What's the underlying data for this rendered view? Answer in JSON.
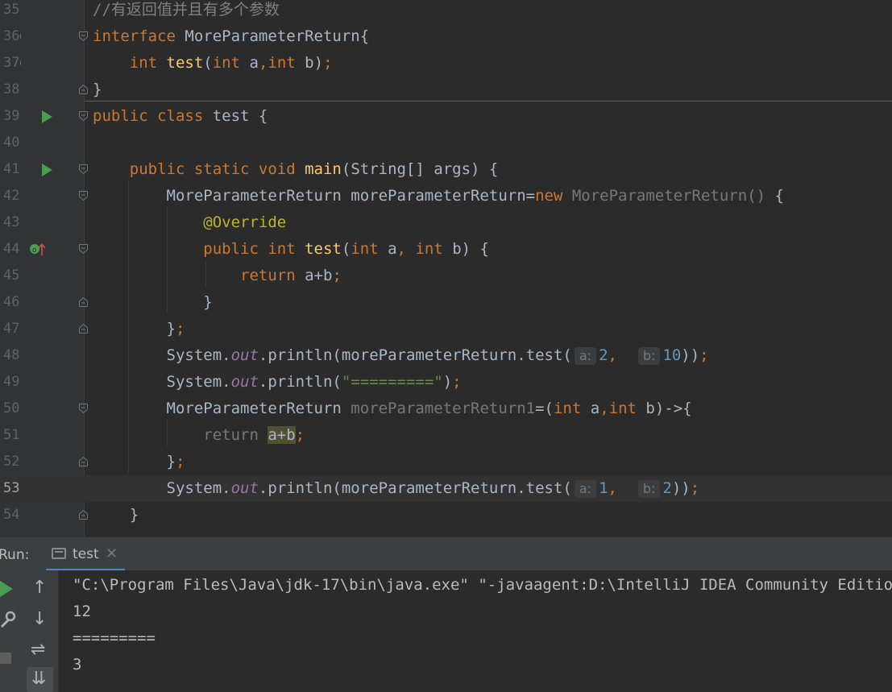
{
  "editor": {
    "lines": [
      {
        "num": "35",
        "tokens": [
          {
            "t": "//有返回值并且有多个参数",
            "c": "c"
          }
        ]
      },
      {
        "num": "36",
        "tokens": [
          {
            "t": "interface",
            "c": "k"
          },
          {
            "t": " MoreParameterReturn{",
            "c": ""
          }
        ]
      },
      {
        "num": "37",
        "tokens": [
          {
            "t": "    int ",
            "c": "k"
          },
          {
            "t": "test",
            "c": "m"
          },
          {
            "t": "(",
            "c": ""
          },
          {
            "t": "int",
            "c": "k"
          },
          {
            "t": " a",
            "c": ""
          },
          {
            "t": ",",
            "c": "k"
          },
          {
            "t": "int",
            "c": "k"
          },
          {
            "t": " b)",
            "c": ""
          },
          {
            "t": ";",
            "c": "k"
          }
        ]
      },
      {
        "num": "38",
        "tokens": [
          {
            "t": "}",
            "c": ""
          }
        ]
      },
      {
        "num": "39",
        "tokens": [
          {
            "t": "public class",
            "c": "k"
          },
          {
            "t": " test {",
            "c": ""
          }
        ]
      },
      {
        "num": "40",
        "tokens": []
      },
      {
        "num": "41",
        "tokens": [
          {
            "t": "    public static void ",
            "c": "k"
          },
          {
            "t": "main",
            "c": "m"
          },
          {
            "t": "(String[] args) {",
            "c": ""
          }
        ]
      },
      {
        "num": "42",
        "tokens": [
          {
            "t": "        MoreParameterReturn moreParameterReturn=",
            "c": ""
          },
          {
            "t": "new ",
            "c": "k"
          },
          {
            "t": "MoreParameterReturn() ",
            "c": "g"
          },
          {
            "t": "{",
            "c": ""
          }
        ]
      },
      {
        "num": "43",
        "tokens": [
          {
            "t": "            @Override",
            "c": "a"
          }
        ]
      },
      {
        "num": "44",
        "tokens": [
          {
            "t": "            public int ",
            "c": "k"
          },
          {
            "t": "test",
            "c": "m"
          },
          {
            "t": "(",
            "c": ""
          },
          {
            "t": "int",
            "c": "k"
          },
          {
            "t": " a",
            "c": ""
          },
          {
            "t": ", ",
            "c": "k"
          },
          {
            "t": "int",
            "c": "k"
          },
          {
            "t": " b) {",
            "c": ""
          }
        ]
      },
      {
        "num": "45",
        "tokens": [
          {
            "t": "                return ",
            "c": "k"
          },
          {
            "t": "a+b",
            "c": ""
          },
          {
            "t": ";",
            "c": "k"
          }
        ]
      },
      {
        "num": "46",
        "tokens": [
          {
            "t": "            }",
            "c": ""
          }
        ]
      },
      {
        "num": "47",
        "tokens": [
          {
            "t": "        }",
            "c": ""
          },
          {
            "t": ";",
            "c": "k"
          }
        ]
      },
      {
        "num": "48",
        "tokens": [
          {
            "t": "        System.",
            "c": ""
          },
          {
            "t": "out",
            "c": "f"
          },
          {
            "t": ".println(moreParameterReturn.test(",
            "c": ""
          },
          {
            "t": "a:",
            "c": "hint"
          },
          {
            "t": "2",
            "c": "n"
          },
          {
            "t": ",  ",
            "c": "k"
          },
          {
            "t": "b:",
            "c": "hint"
          },
          {
            "t": "10",
            "c": "n"
          },
          {
            "t": "))",
            "c": ""
          },
          {
            "t": ";",
            "c": "k"
          }
        ]
      },
      {
        "num": "49",
        "tokens": [
          {
            "t": "        System.",
            "c": ""
          },
          {
            "t": "out",
            "c": "f"
          },
          {
            "t": ".println(",
            "c": ""
          },
          {
            "t": "\"=========\"",
            "c": "s"
          },
          {
            "t": ")",
            "c": ""
          },
          {
            "t": ";",
            "c": "k"
          }
        ]
      },
      {
        "num": "50",
        "tokens": [
          {
            "t": "        MoreParameterReturn ",
            "c": ""
          },
          {
            "t": "moreParameterReturn1",
            "c": "g"
          },
          {
            "t": "=(",
            "c": ""
          },
          {
            "t": "int",
            "c": "k"
          },
          {
            "t": " a",
            "c": ""
          },
          {
            "t": ",",
            "c": "k"
          },
          {
            "t": "int",
            "c": "k"
          },
          {
            "t": " b)->{",
            "c": ""
          }
        ]
      },
      {
        "num": "51",
        "tokens": [
          {
            "t": "            return ",
            "c": "g"
          },
          {
            "t": "a+b",
            "c": "hl"
          },
          {
            "t": ";",
            "c": "k"
          }
        ]
      },
      {
        "num": "52",
        "tokens": [
          {
            "t": "        }",
            "c": ""
          },
          {
            "t": ";",
            "c": "k"
          }
        ]
      },
      {
        "num": "53",
        "current": true,
        "tokens": [
          {
            "t": "        System.",
            "c": ""
          },
          {
            "t": "out",
            "c": "f"
          },
          {
            "t": ".println(moreParameterReturn.test(",
            "c": ""
          },
          {
            "t": "a:",
            "c": "hint"
          },
          {
            "t": "1",
            "c": "n"
          },
          {
            "t": ",  ",
            "c": "k"
          },
          {
            "t": "b:",
            "c": "hint"
          },
          {
            "t": "2",
            "c": "n"
          },
          {
            "t": "))",
            "c": ""
          },
          {
            "t": ";",
            "c": "k"
          }
        ]
      },
      {
        "num": "54",
        "tokens": [
          {
            "t": "    }",
            "c": ""
          }
        ]
      }
    ]
  },
  "run_panel": {
    "label": "Run:",
    "tab_label": "test",
    "tab_close": "×",
    "console_lines": [
      "\"C:\\Program Files\\Java\\jdk-17\\bin\\java.exe\" \"-javaagent:D:\\IntelliJ IDEA Community Edition",
      "12",
      "=========",
      "3"
    ]
  },
  "icons": {
    "up": "↑",
    "down": "↓",
    "wrap": "⇌",
    "sort": "⇊",
    "wrench": "🔧"
  },
  "colors": {
    "keyword": "#cc7832",
    "text": "#a9b7c6",
    "number": "#6897bb",
    "string": "#6a8759",
    "annotation": "#bbb529",
    "method": "#ffc66d",
    "static_field": "#9876aa"
  }
}
